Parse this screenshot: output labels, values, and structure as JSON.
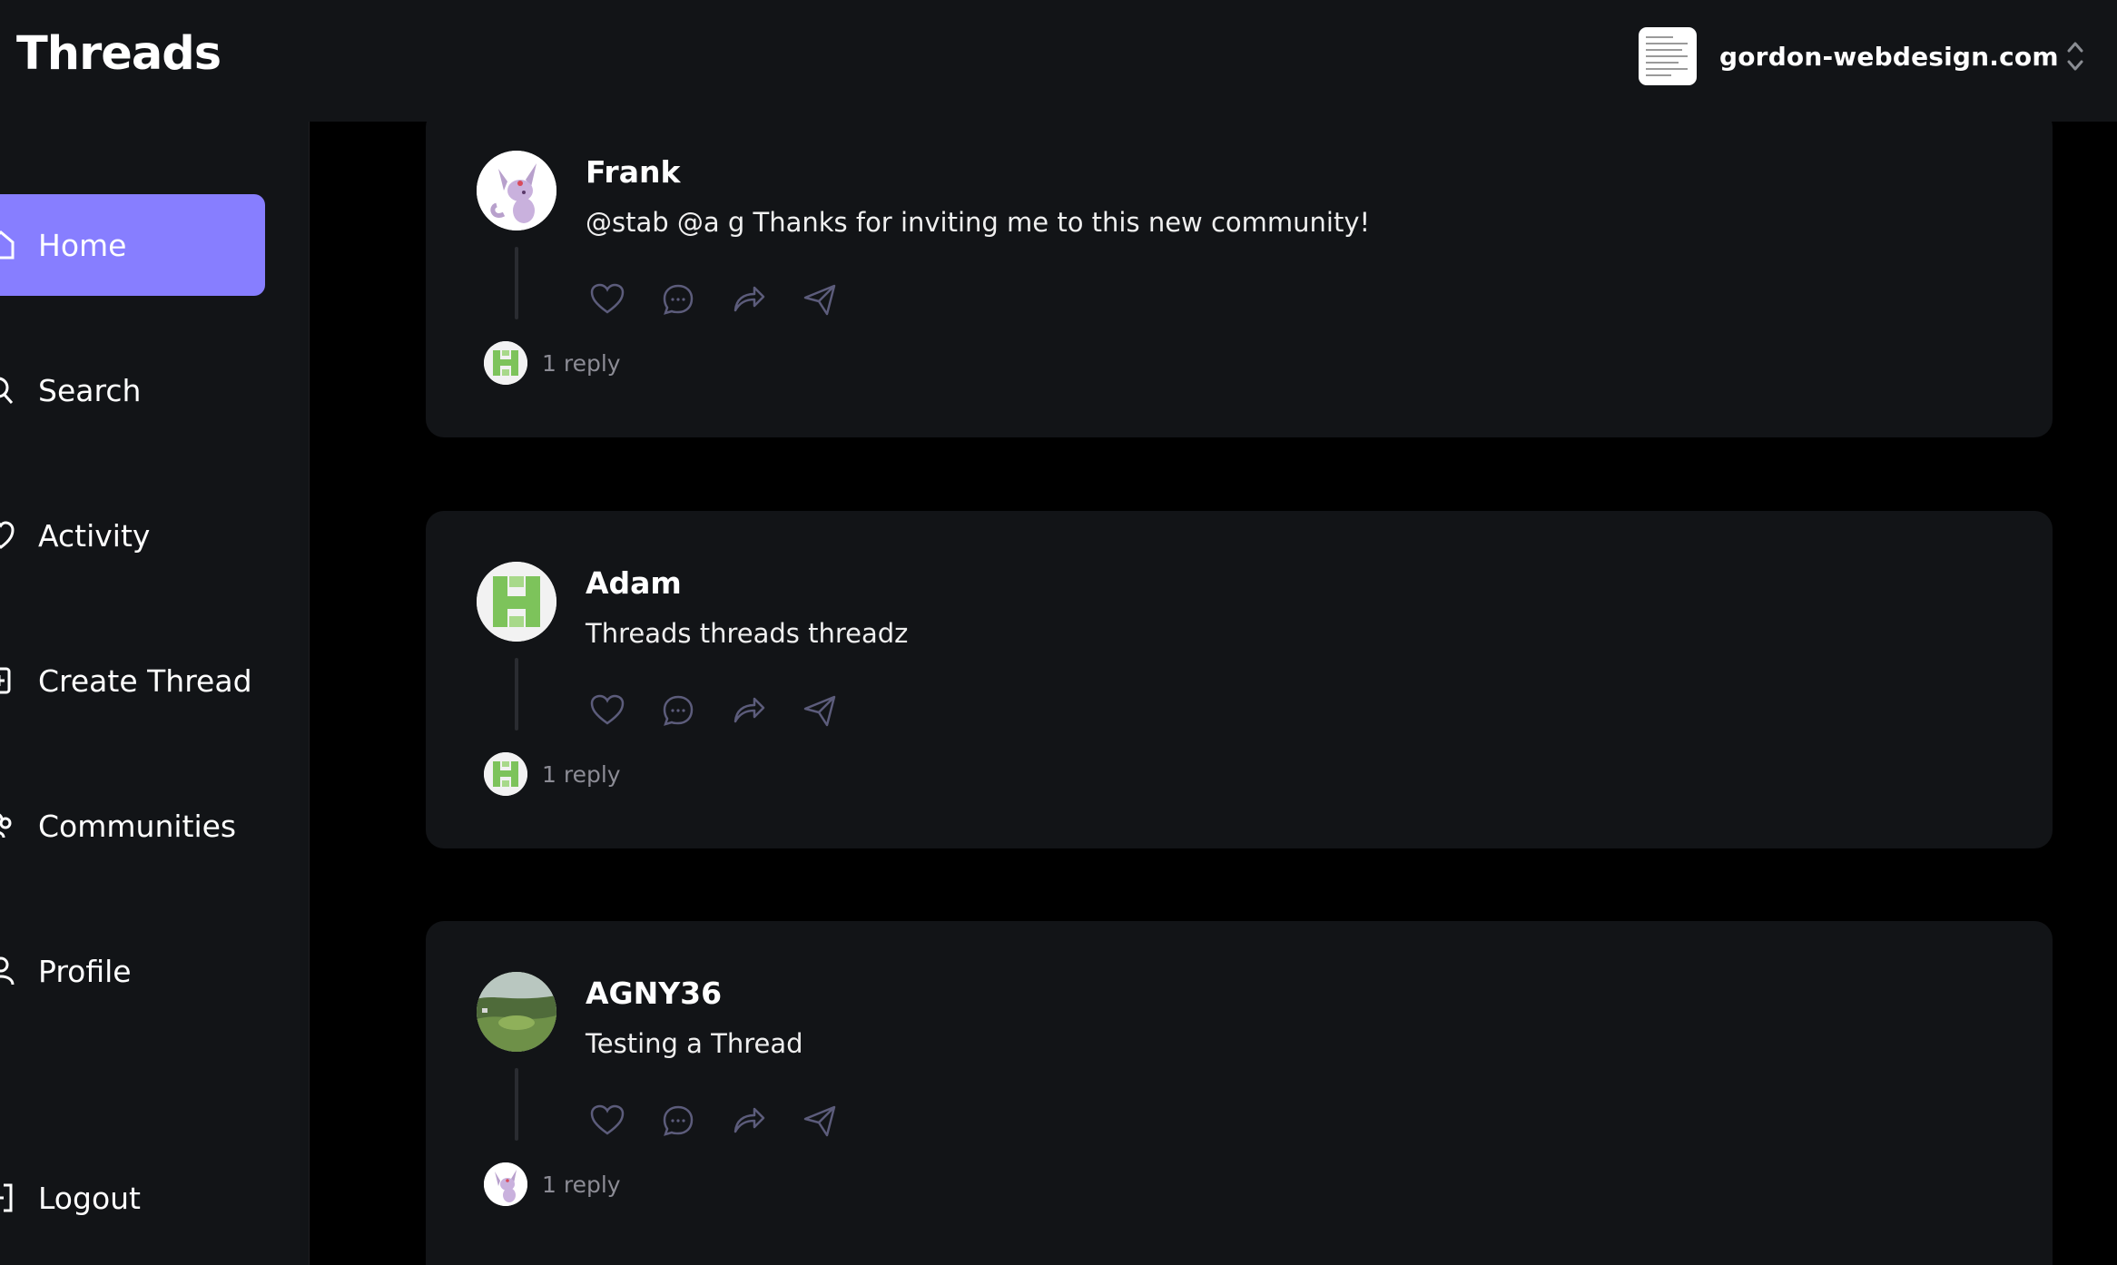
{
  "topbar": {
    "brand": "Threads",
    "org_name": "gordon-webdesign.com"
  },
  "sidebar": {
    "items": [
      {
        "label": "Home",
        "icon": "home-icon",
        "active": true
      },
      {
        "label": "Search",
        "icon": "search-icon",
        "active": false
      },
      {
        "label": "Activity",
        "icon": "heart-icon",
        "active": false
      },
      {
        "label": "Create Thread",
        "icon": "create-icon",
        "active": false
      },
      {
        "label": "Communities",
        "icon": "communities-icon",
        "active": false
      },
      {
        "label": "Profile",
        "icon": "user-icon",
        "active": false
      }
    ],
    "logout": {
      "label": "Logout",
      "icon": "logout-icon"
    }
  },
  "threads": [
    {
      "author": "Frank",
      "content": "@stab @a g Thanks for inviting me to this new community!",
      "replies": "1 reply"
    },
    {
      "author": "Adam",
      "content": "Threads threads threadz",
      "replies": "1 reply"
    },
    {
      "author": "AGNY36",
      "content": "Testing a Thread",
      "replies": "1 reply"
    }
  ],
  "colors": {
    "accent": "#877eff",
    "surface": "#121417",
    "background": "#000000",
    "muted_text": "#8c8c95"
  }
}
